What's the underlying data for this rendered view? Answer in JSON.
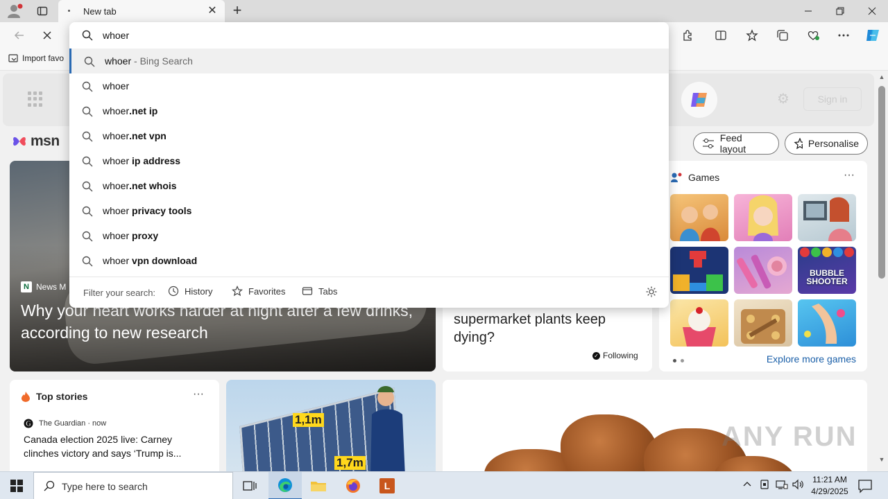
{
  "browser": {
    "tab_title": "New tab",
    "new_tab_symbol": "+",
    "close_symbol": "✕",
    "bookmark_label": "Import favo"
  },
  "omnibox": {
    "query": "whoer",
    "suggestions": [
      {
        "prefix": "whoer",
        "suffix": " - Bing Search",
        "kind": "bing"
      },
      {
        "prefix": "whoer",
        "suffix": "",
        "kind": "plain"
      },
      {
        "prefix": "whoer",
        "suffix": ".net ip",
        "kind": "bold"
      },
      {
        "prefix": "whoer",
        "suffix": ".net vpn",
        "kind": "bold"
      },
      {
        "prefix": "whoer",
        "suffix": " ip address",
        "kind": "bold"
      },
      {
        "prefix": "whoer",
        "suffix": ".net whois",
        "kind": "bold"
      },
      {
        "prefix": "whoer",
        "suffix": " privacy tools",
        "kind": "bold"
      },
      {
        "prefix": "whoer",
        "suffix": " proxy",
        "kind": "bold"
      },
      {
        "prefix": "whoer",
        "suffix": " vpn download",
        "kind": "bold"
      }
    ],
    "filter_label": "Filter your search:",
    "filters": [
      "History",
      "Favorites",
      "Tabs"
    ]
  },
  "msn": {
    "logo_text": "msn",
    "sign_in": "Sign in",
    "feed_layout": "Feed layout",
    "personalise": "Personalise",
    "hero": {
      "source": "News M",
      "title": "Why your heart works harder at night after a few drinks, according to new research"
    },
    "mid_card": {
      "title": "supermarket plants keep dying?",
      "following": "Following"
    },
    "games": {
      "title": "Games",
      "more": "···",
      "tile_labels": [
        "BUBBLE SHOOTER"
      ],
      "explore": "Explore more games"
    },
    "top_stories": {
      "title": "Top stories",
      "more": "···",
      "source": "The Guardian · now",
      "headline": "Canada election 2025 live: Carney clinches victory and says ‘Trump is..."
    },
    "solar_labels": [
      "1,1m",
      "1,7m"
    ],
    "watermark": "ANY RUN"
  },
  "taskbar": {
    "search_placeholder": "Type here to search",
    "time": "11:21 AM",
    "date": "4/29/2025"
  },
  "colors": {
    "accent": "#2a6ab3",
    "link": "#1a5fa8",
    "titlebar": "#dcdcdc",
    "taskbar": "#dfe7f0"
  }
}
